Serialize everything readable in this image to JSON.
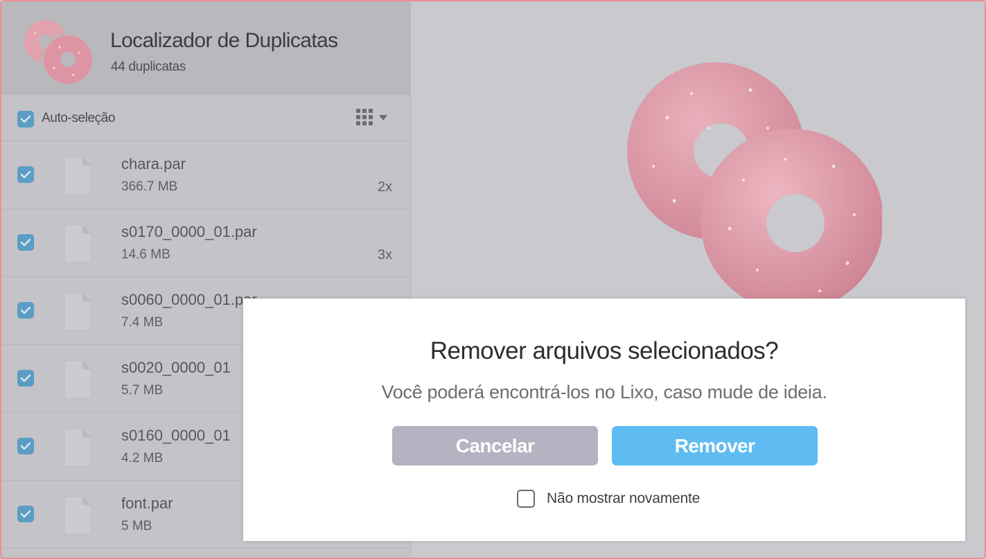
{
  "app": {
    "title": "Localizador de Duplicatas",
    "subtitle": "44 duplicatas",
    "icon": "pink-donuts-icon"
  },
  "toolbar": {
    "auto_select_label": "Auto-seleção",
    "auto_select_checked": true,
    "view_icon": "grid-view-icon"
  },
  "files": [
    {
      "name": "chara.par",
      "size": "366.7 MB",
      "count": "2x",
      "checked": true
    },
    {
      "name": "s0170_0000_01.par",
      "size": "14.6 MB",
      "count": "3x",
      "checked": true
    },
    {
      "name": "s0060_0000_01.par",
      "size": "7.4 MB",
      "count": "",
      "checked": true
    },
    {
      "name": "s0020_0000_01",
      "size": "5.7 MB",
      "count": "",
      "checked": true
    },
    {
      "name": "s0160_0000_01",
      "size": "4.2 MB",
      "count": "",
      "checked": true
    },
    {
      "name": "font.par",
      "size": "5 MB",
      "count": "",
      "checked": true
    }
  ],
  "dialog": {
    "title": "Remover arquivos selecionados?",
    "message": "Você poderá encontrá-los no Lixo, caso mude de ideia.",
    "cancel_label": "Cancelar",
    "remove_label": "Remover",
    "dont_show_label": "Não mostrar novamente",
    "dont_show_checked": false
  },
  "colors": {
    "accent": "#5ebcf2",
    "cancel": "#b3b3c1",
    "checkbox": "#5b9dc4",
    "donut": "#e8a0ae",
    "window_border": "#ee8f93"
  }
}
